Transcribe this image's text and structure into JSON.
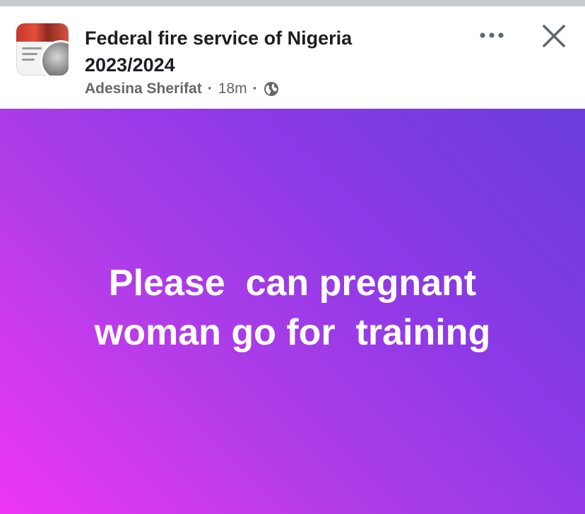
{
  "header": {
    "title_line1": "Federal fire service of Nigeria",
    "title_line2": "2023/2024",
    "author": "Adesina Sherifat",
    "separator": "·",
    "time": "18m",
    "privacy_icon": "globe-icon",
    "more_icon": "more-dots-icon",
    "close_icon": "close-icon"
  },
  "post": {
    "text_line1": "Please  can pregnant",
    "text_line2": "woman go for  training",
    "text_color": "#ffffff"
  },
  "colors": {
    "gradient_top_right": "#6a3ddc",
    "gradient_bottom_left": "#ee35f7",
    "meta_text": "#65676b",
    "title_text": "#1c1e21"
  }
}
